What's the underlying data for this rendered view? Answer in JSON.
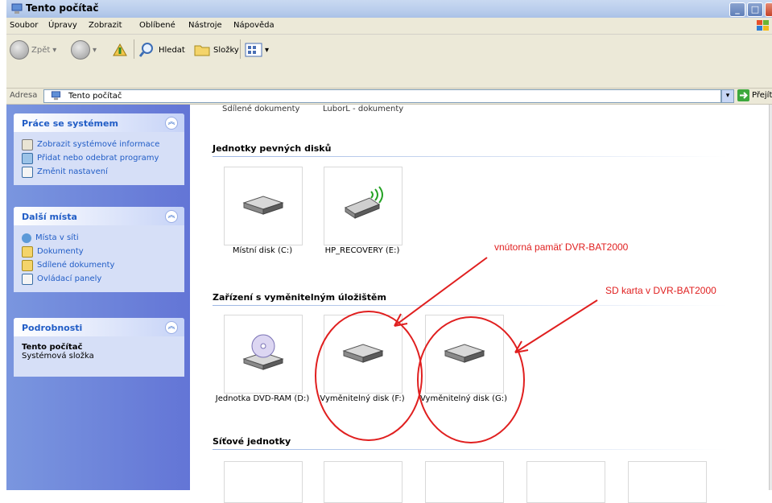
{
  "window": {
    "title": "Tento počítač"
  },
  "menu": [
    "Soubor",
    "Úpravy",
    "Zobrazit",
    "Oblíbené",
    "Nástroje",
    "Nápověda"
  ],
  "toolbar": {
    "back": "Zpět",
    "search": "Hledat",
    "folders": "Složky"
  },
  "address": {
    "label": "Adresa",
    "value": "Tento počítač",
    "go": "Přejít"
  },
  "tasks_panel": {
    "title": "Práce se systémem",
    "items": [
      "Zobrazit systémové informace",
      "Přidat nebo odebrat programy",
      "Změnit nastavení"
    ]
  },
  "places_panel": {
    "title": "Další místa",
    "items": [
      "Místa v síti",
      "Dokumenty",
      "Sdílené dokumenty",
      "Ovládací panely"
    ]
  },
  "details_panel": {
    "title": "Podrobnosti",
    "name": "Tento počítač",
    "type": "Systémová složka"
  },
  "top_cut_labels": [
    "Sdílené dokumenty",
    "LuborL - dokumenty"
  ],
  "hard_disks": {
    "title": "Jednotky pevných disků",
    "items": [
      "Místní disk (C:)",
      "HP_RECOVERY (E:)"
    ]
  },
  "removable": {
    "title": "Zařízení s vyměnitelným úložištěm",
    "items": [
      "Jednotka DVD-RAM (D:)",
      "Vyměnitelný disk (F:)",
      "Vyměnitelný disk (G:)"
    ]
  },
  "network": {
    "title": "Síťové jednotky"
  },
  "annotations": {
    "internal": "vnútorná pamäť DVR-BAT2000",
    "sd": "SD karta v DVR-BAT2000"
  },
  "colors": {
    "annotation": "#e01f1f",
    "taskpane": "#6f86da"
  }
}
